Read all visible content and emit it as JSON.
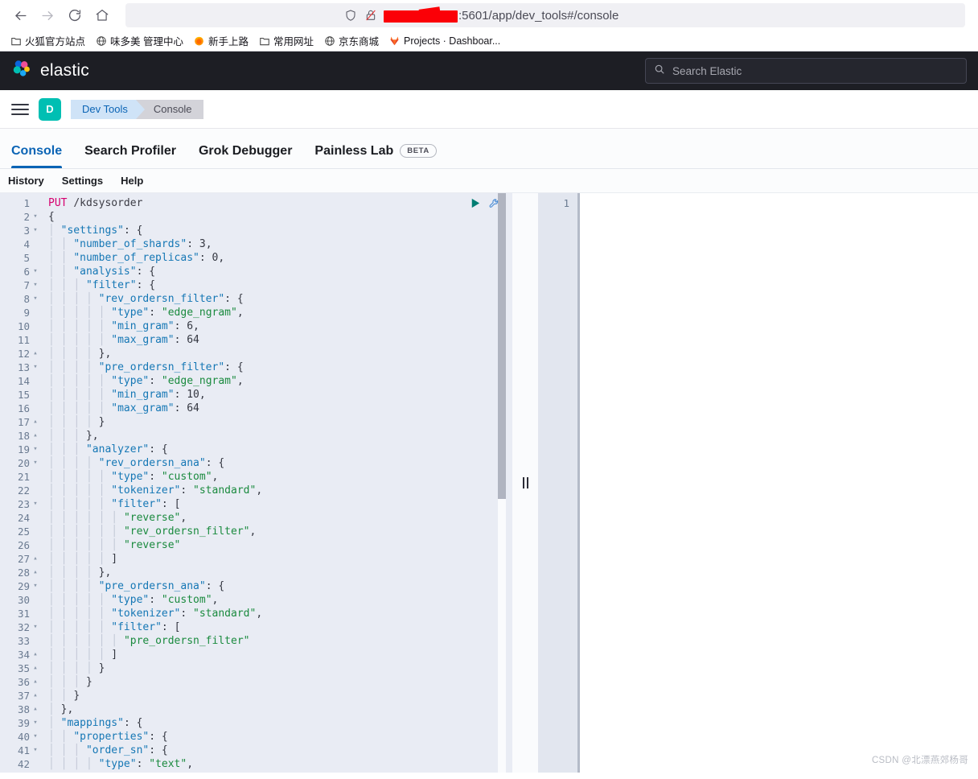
{
  "browser": {
    "nav": {
      "back": "back-arrow",
      "forward": "forward-arrow",
      "reload": "reload",
      "home": "home"
    },
    "url": {
      "prefix_redacted": true,
      "visible_text": ":5601/app/dev_tools#/console",
      "shield_icon": "shield-icon",
      "lock_icon": "lock-slashed-icon"
    },
    "bookmarks": [
      {
        "label": "火狐官方站点",
        "icon": "folder-icon"
      },
      {
        "label": "味多美 管理中心",
        "icon": "globe-icon"
      },
      {
        "label": "新手上路",
        "icon": "firefox-icon"
      },
      {
        "label": "常用网址",
        "icon": "folder-icon"
      },
      {
        "label": "京东商城",
        "icon": "globe-icon"
      },
      {
        "label": "Projects · Dashboar...",
        "icon": "gitlab-icon"
      }
    ]
  },
  "elastic_header": {
    "brand": "elastic",
    "logo_icon": "elastic-logo-icon",
    "search": {
      "placeholder": "Search Elastic",
      "icon": "search-icon"
    }
  },
  "breadcrumb_bar": {
    "menu_icon": "hamburger-menu-icon",
    "space_initial": "D",
    "crumbs": [
      {
        "label": "Dev Tools"
      },
      {
        "label": "Console"
      }
    ]
  },
  "app_tabs": [
    {
      "label": "Console",
      "active": true
    },
    {
      "label": "Search Profiler",
      "active": false
    },
    {
      "label": "Grok Debugger",
      "active": false
    },
    {
      "label": "Painless Lab",
      "active": false,
      "badge": "BETA"
    }
  ],
  "console_menu": [
    {
      "label": "History"
    },
    {
      "label": "Settings"
    },
    {
      "label": "Help"
    }
  ],
  "editor": {
    "actions": {
      "play": "play-triangle-icon",
      "wrench": "wrench-icon"
    },
    "request_lines": [
      {
        "n": 1,
        "fold": "",
        "text": "PUT /kdsysorder"
      },
      {
        "n": 2,
        "fold": "▾",
        "text": "{"
      },
      {
        "n": 3,
        "fold": "▾",
        "text": "  \"settings\": {"
      },
      {
        "n": 4,
        "fold": "",
        "text": "    \"number_of_shards\": 3,"
      },
      {
        "n": 5,
        "fold": "",
        "text": "    \"number_of_replicas\": 0,"
      },
      {
        "n": 6,
        "fold": "▾",
        "text": "    \"analysis\": {"
      },
      {
        "n": 7,
        "fold": "▾",
        "text": "      \"filter\": {"
      },
      {
        "n": 8,
        "fold": "▾",
        "text": "        \"rev_ordersn_filter\": {"
      },
      {
        "n": 9,
        "fold": "",
        "text": "          \"type\": \"edge_ngram\","
      },
      {
        "n": 10,
        "fold": "",
        "text": "          \"min_gram\": 6,"
      },
      {
        "n": 11,
        "fold": "",
        "text": "          \"max_gram\": 64"
      },
      {
        "n": 12,
        "fold": "▴",
        "text": "        },"
      },
      {
        "n": 13,
        "fold": "▾",
        "text": "        \"pre_ordersn_filter\": {"
      },
      {
        "n": 14,
        "fold": "",
        "text": "          \"type\": \"edge_ngram\","
      },
      {
        "n": 15,
        "fold": "",
        "text": "          \"min_gram\": 10,"
      },
      {
        "n": 16,
        "fold": "",
        "text": "          \"max_gram\": 64"
      },
      {
        "n": 17,
        "fold": "▴",
        "text": "        }"
      },
      {
        "n": 18,
        "fold": "▴",
        "text": "      },"
      },
      {
        "n": 19,
        "fold": "▾",
        "text": "      \"analyzer\": {"
      },
      {
        "n": 20,
        "fold": "▾",
        "text": "        \"rev_ordersn_ana\": {"
      },
      {
        "n": 21,
        "fold": "",
        "text": "          \"type\": \"custom\","
      },
      {
        "n": 22,
        "fold": "",
        "text": "          \"tokenizer\": \"standard\","
      },
      {
        "n": 23,
        "fold": "▾",
        "text": "          \"filter\": ["
      },
      {
        "n": 24,
        "fold": "",
        "text": "            \"reverse\","
      },
      {
        "n": 25,
        "fold": "",
        "text": "            \"rev_ordersn_filter\","
      },
      {
        "n": 26,
        "fold": "",
        "text": "            \"reverse\""
      },
      {
        "n": 27,
        "fold": "▴",
        "text": "          ]"
      },
      {
        "n": 28,
        "fold": "▴",
        "text": "        },"
      },
      {
        "n": 29,
        "fold": "▾",
        "text": "        \"pre_ordersn_ana\": {"
      },
      {
        "n": 30,
        "fold": "",
        "text": "          \"type\": \"custom\","
      },
      {
        "n": 31,
        "fold": "",
        "text": "          \"tokenizer\": \"standard\","
      },
      {
        "n": 32,
        "fold": "▾",
        "text": "          \"filter\": ["
      },
      {
        "n": 33,
        "fold": "",
        "text": "            \"pre_ordersn_filter\""
      },
      {
        "n": 34,
        "fold": "▴",
        "text": "          ]"
      },
      {
        "n": 35,
        "fold": "▴",
        "text": "        }"
      },
      {
        "n": 36,
        "fold": "▴",
        "text": "      }"
      },
      {
        "n": 37,
        "fold": "▴",
        "text": "    }"
      },
      {
        "n": 38,
        "fold": "▴",
        "text": "  },"
      },
      {
        "n": 39,
        "fold": "▾",
        "text": "  \"mappings\": {"
      },
      {
        "n": 40,
        "fold": "▾",
        "text": "    \"properties\": {"
      },
      {
        "n": 41,
        "fold": "▾",
        "text": "      \"order_sn\": {"
      },
      {
        "n": 42,
        "fold": "",
        "text": "        \"type\": \"text\","
      }
    ],
    "response_lines": [
      {
        "n": 1,
        "text": ""
      }
    ]
  },
  "watermark": "CSDN @北漂燕郊杨哥",
  "colors": {
    "elastic_dark": "#1d1e24",
    "accent_blue": "#0b64b5",
    "teal": "#00bfb3",
    "editor_bg": "#e9ecf4",
    "key": "#1577b5",
    "string": "#1a8a3e",
    "method": "#d6006e"
  }
}
